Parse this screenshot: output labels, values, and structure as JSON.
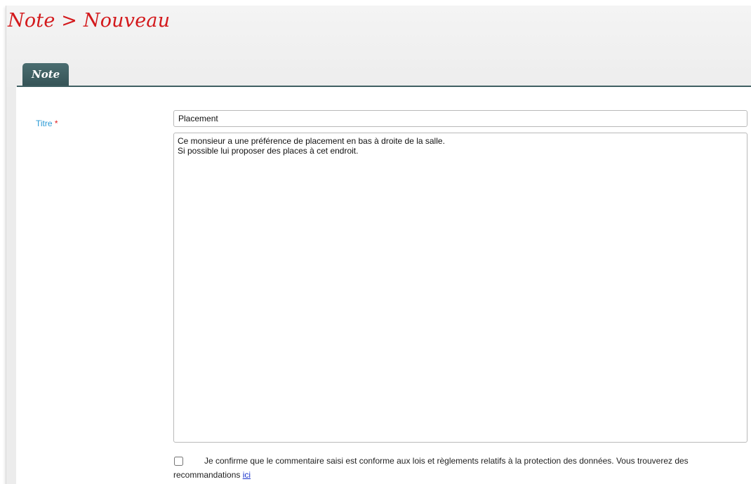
{
  "header": {
    "page_title": "Note > Nouveau"
  },
  "tabs": [
    {
      "label": "Note",
      "active": true
    }
  ],
  "form": {
    "title_label": "Titre",
    "required_mark": "*",
    "title_value": "Placement",
    "note_body": "Ce monsieur a une préférence de placement en bas à droite de la salle.\nSi possible lui proposer des places à cet endroit.",
    "confirm_checked": false,
    "confirm_text": "Je confirme que le commentaire saisi est conforme aux lois et règlements relatifs à la protection des données. Vous trouverez des recommandations",
    "confirm_link": "ici"
  },
  "colors": {
    "title_red": "#d3191c",
    "tab_teal": "#3f5f62",
    "label_blue": "#2a9ad5",
    "link_blue": "#1a33cc"
  }
}
